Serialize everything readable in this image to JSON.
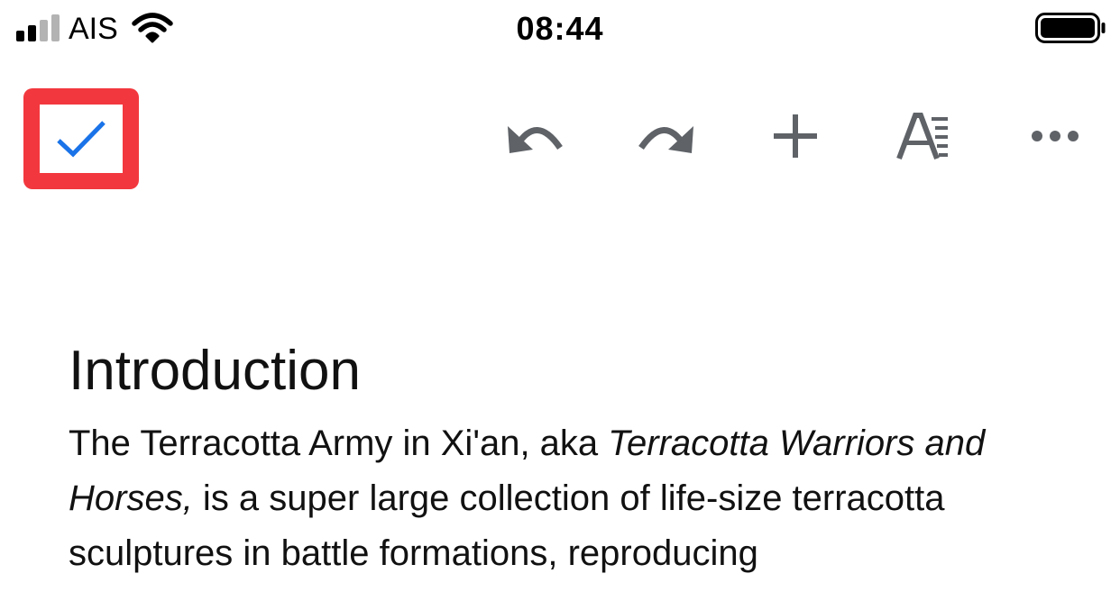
{
  "status_bar": {
    "carrier": "AIS",
    "time": "08:44",
    "signal_bars_active": 2,
    "signal_bars_total": 4,
    "battery_level": 1.0
  },
  "toolbar": {
    "done_icon": "checkmark-icon",
    "highlight_color": "#f2383e",
    "checkmark_color": "#1a73e8",
    "icon_color": "#5f6368",
    "tools": [
      "undo-icon",
      "redo-icon",
      "plus-icon",
      "text-format-icon",
      "more-icon"
    ]
  },
  "document": {
    "heading": "Introduction",
    "body_part1": "The Terracotta Army in Xi'an, aka ",
    "body_italic": "Terracotta Warriors and Horses,",
    "body_part2": " is a super large collection of life-size terracotta sculptures in battle formations, reproducing"
  }
}
